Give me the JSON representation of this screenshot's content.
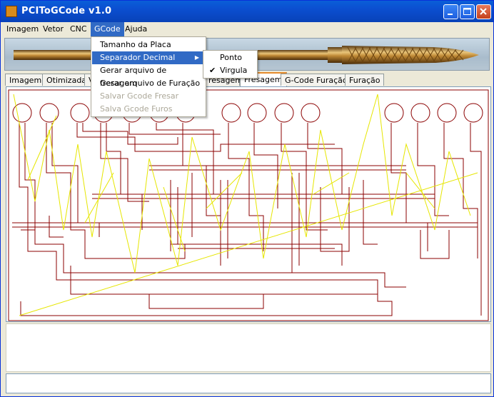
{
  "window": {
    "title": "PCIToGCode  v1.0"
  },
  "menubar": [
    "Imagem",
    "Vetor",
    "CNC",
    "GCode",
    "Ajuda"
  ],
  "tabs": [
    "Imagem",
    "Otimizada",
    "V",
    "resagem",
    "Fresagem",
    "G-Code Furação",
    "Furação"
  ],
  "gcode_menu": {
    "items": [
      {
        "label": "Tamanho da Placa",
        "enabled": true
      },
      {
        "label": "Separador Decimal",
        "enabled": true,
        "highlighted": true,
        "has_submenu": true
      },
      {
        "label": "Gerar arquivo de fresagem",
        "enabled": true
      },
      {
        "label": "Gerar arquivo de Furação",
        "enabled": true
      },
      {
        "label": "Salvar Gcode Fresar",
        "enabled": false
      },
      {
        "label": "Salva Gcode Furos",
        "enabled": false
      }
    ]
  },
  "separator_submenu": {
    "items": [
      {
        "label": "Ponto",
        "checked": false
      },
      {
        "label": "Virgula",
        "checked": true
      }
    ],
    "check_glyph": "✔"
  },
  "colors": {
    "trace": "#8b0000",
    "toolpath": "#e6e600",
    "highlight": "#316ac5",
    "titlebar": "#0b4ed0"
  }
}
